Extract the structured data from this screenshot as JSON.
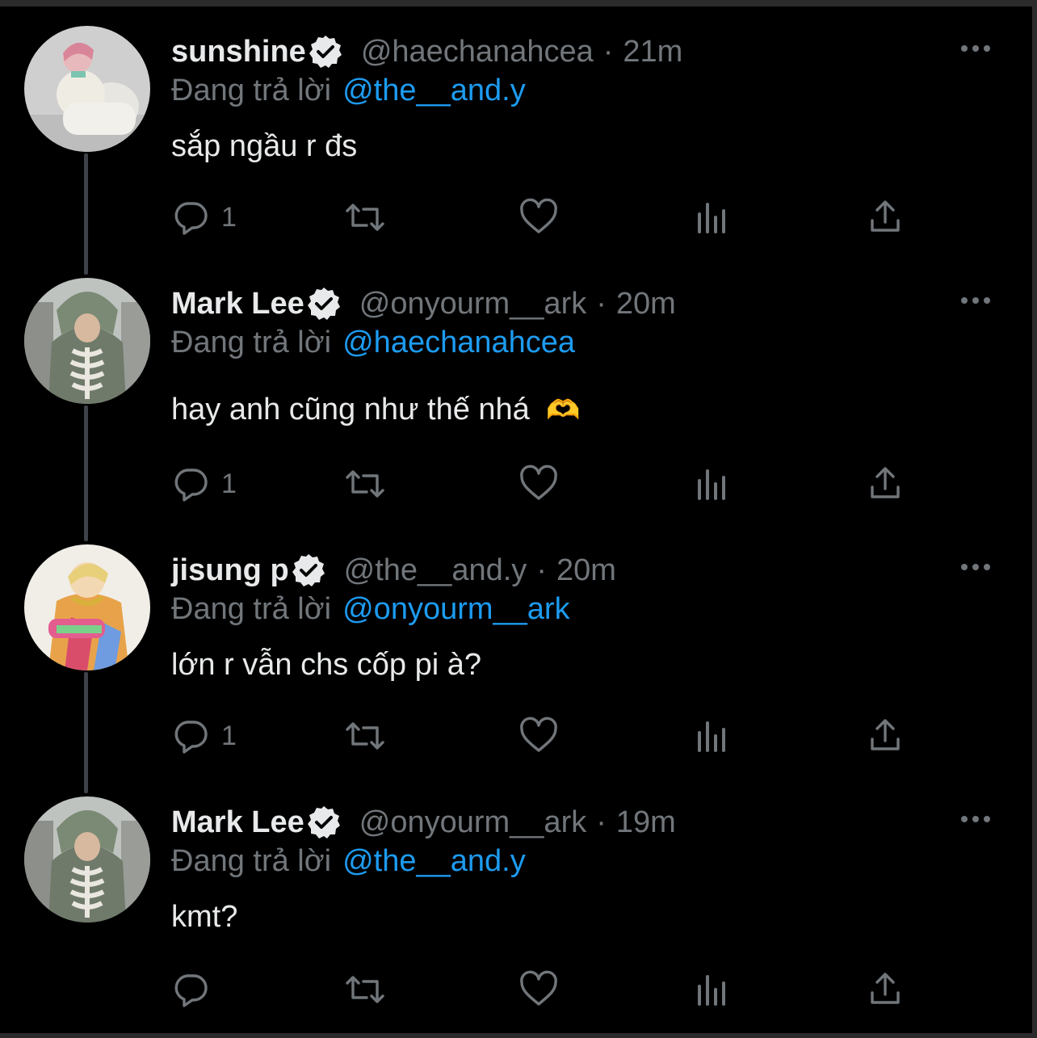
{
  "colors": {
    "background": "#000000",
    "text": "#e7e9ea",
    "secondary": "#71767b",
    "link": "#1d9bf0",
    "thread_line": "#3d4248"
  },
  "reply_prefix": "Đang trả lời",
  "tweets": [
    {
      "name": "sunshine",
      "handle": "@haechanahcea",
      "time": "21m",
      "dot": "·",
      "reply_to": "@the__and.y",
      "text": "sắp ngầu r đs",
      "reply_count": "1",
      "icons": [
        "reply-icon",
        "retweet-icon",
        "like-icon",
        "analytics-icon",
        "share-icon"
      ]
    },
    {
      "name": "Mark Lee",
      "handle": "@onyourm__ark",
      "time": "20m",
      "dot": "·",
      "reply_to": "@haechanahcea",
      "text": "hay anh cũng như thế nhá",
      "emoji": "🫶",
      "reply_count": "1",
      "icons": [
        "reply-icon",
        "retweet-icon",
        "like-icon",
        "analytics-icon",
        "share-icon"
      ]
    },
    {
      "name": "jisung p",
      "handle": "@the__and.y",
      "time": "20m",
      "dot": "·",
      "reply_to": "@onyourm__ark",
      "text": "lớn r vẫn chs cốp pi à?",
      "reply_count": "1",
      "icons": [
        "reply-icon",
        "retweet-icon",
        "like-icon",
        "analytics-icon",
        "share-icon"
      ]
    },
    {
      "name": "Mark Lee",
      "handle": "@onyourm__ark",
      "time": "19m",
      "dot": "·",
      "reply_to": "@the__and.y",
      "text": "kmt?",
      "reply_count": "",
      "icons": [
        "reply-icon",
        "retweet-icon",
        "like-icon",
        "analytics-icon",
        "share-icon"
      ]
    }
  ]
}
